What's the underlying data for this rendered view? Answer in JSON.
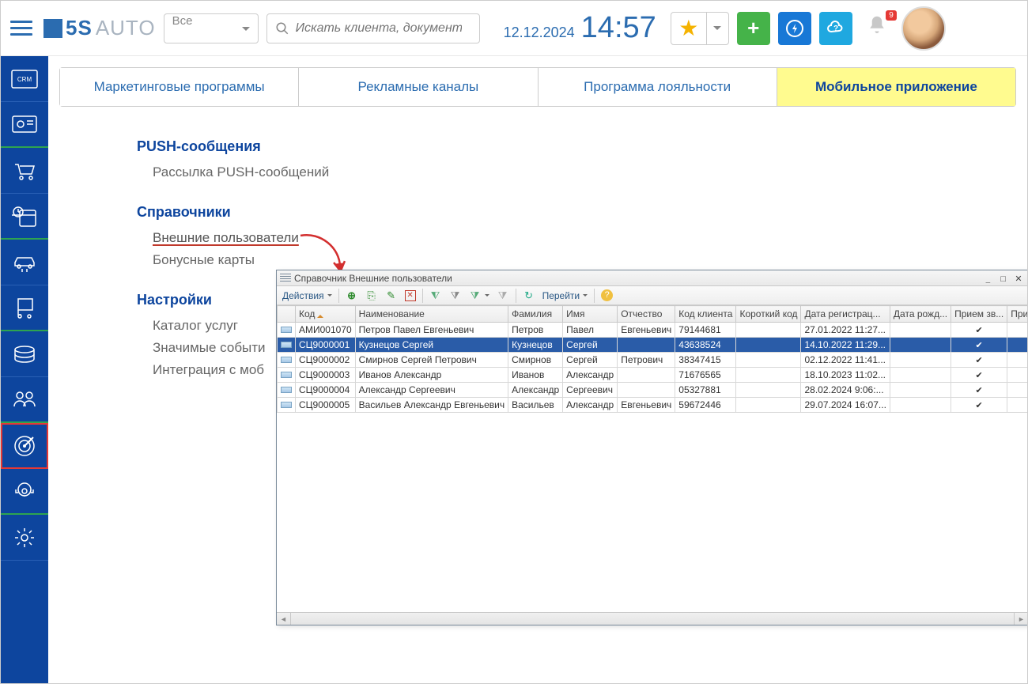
{
  "header": {
    "brand_5s": "5S",
    "brand_auto": "AUTO",
    "select_label": "Все",
    "search_placeholder": "Искать клиента, документ ..",
    "date": "12.12.2024",
    "time": "14:57",
    "badge": "9"
  },
  "tabs": [
    "Маркетинговые программы",
    "Рекламные каналы",
    "Программа лояльности",
    "Мобильное приложение"
  ],
  "sections": {
    "push_head": "PUSH-сообщения",
    "push_item": "Рассылка PUSH-сообщений",
    "ref_head": "Справочники",
    "ref_item1": "Внешние пользователи",
    "ref_item2": "Бонусные карты",
    "set_head": "Настройки",
    "set_item1": "Каталог услуг",
    "set_item2": "Значимые событи",
    "set_item3": "Интеграция с моб"
  },
  "dialog": {
    "title": "Справочник Внешние пользователи",
    "actions": "Действия",
    "goto": "Перейти",
    "columns": [
      "",
      "Код",
      "Наименование",
      "Фамилия",
      "Имя",
      "Отчество",
      "Код клиента",
      "Короткий код",
      "Дата регистрац...",
      "Дата рожд...",
      "Прием зв...",
      "Прием s..."
    ],
    "rows": [
      {
        "code": "АМИ001070",
        "name": "Петров Павел Евгеньевич",
        "fam": "Петров",
        "imya": "Павел",
        "otch": "Евгеньевич",
        "kk": "79144681",
        "short": "",
        "reg": "27.01.2022 11:27...",
        "dob": "",
        "zv": "✔",
        "sm": "✔"
      },
      {
        "code": "СЦ9000001",
        "name": "Кузнецов Сергей",
        "fam": "Кузнецов",
        "imya": "Сергей",
        "otch": "",
        "kk": "43638524",
        "short": "",
        "reg": "14.10.2022 11:29...",
        "dob": "",
        "zv": "✔",
        "sm": "✔"
      },
      {
        "code": "СЦ9000002",
        "name": "Смирнов Сергей Петрович",
        "fam": "Смирнов",
        "imya": "Сергей",
        "otch": "Петрович",
        "kk": "38347415",
        "short": "",
        "reg": "02.12.2022 11:41...",
        "dob": "",
        "zv": "✔",
        "sm": "✔"
      },
      {
        "code": "СЦ9000003",
        "name": "Иванов Александр",
        "fam": "Иванов",
        "imya": "Александр",
        "otch": "",
        "kk": "71676565",
        "short": "",
        "reg": "18.10.2023 11:02...",
        "dob": "",
        "zv": "✔",
        "sm": "✔"
      },
      {
        "code": "СЦ9000004",
        "name": "Александр Сергеевич",
        "fam": "Александр",
        "imya": "Сергеевич",
        "otch": "",
        "kk": "05327881",
        "short": "",
        "reg": "28.02.2024 9:06:...",
        "dob": "",
        "zv": "✔",
        "sm": "✔"
      },
      {
        "code": "СЦ9000005",
        "name": "Васильев Александр Евгеньевич",
        "fam": "Васильев",
        "imya": "Александр",
        "otch": "Евгеньевич",
        "kk": "59672446",
        "short": "",
        "reg": "29.07.2024 16:07...",
        "dob": "",
        "zv": "✔",
        "sm": "✔"
      }
    ],
    "selected_index": 1
  }
}
